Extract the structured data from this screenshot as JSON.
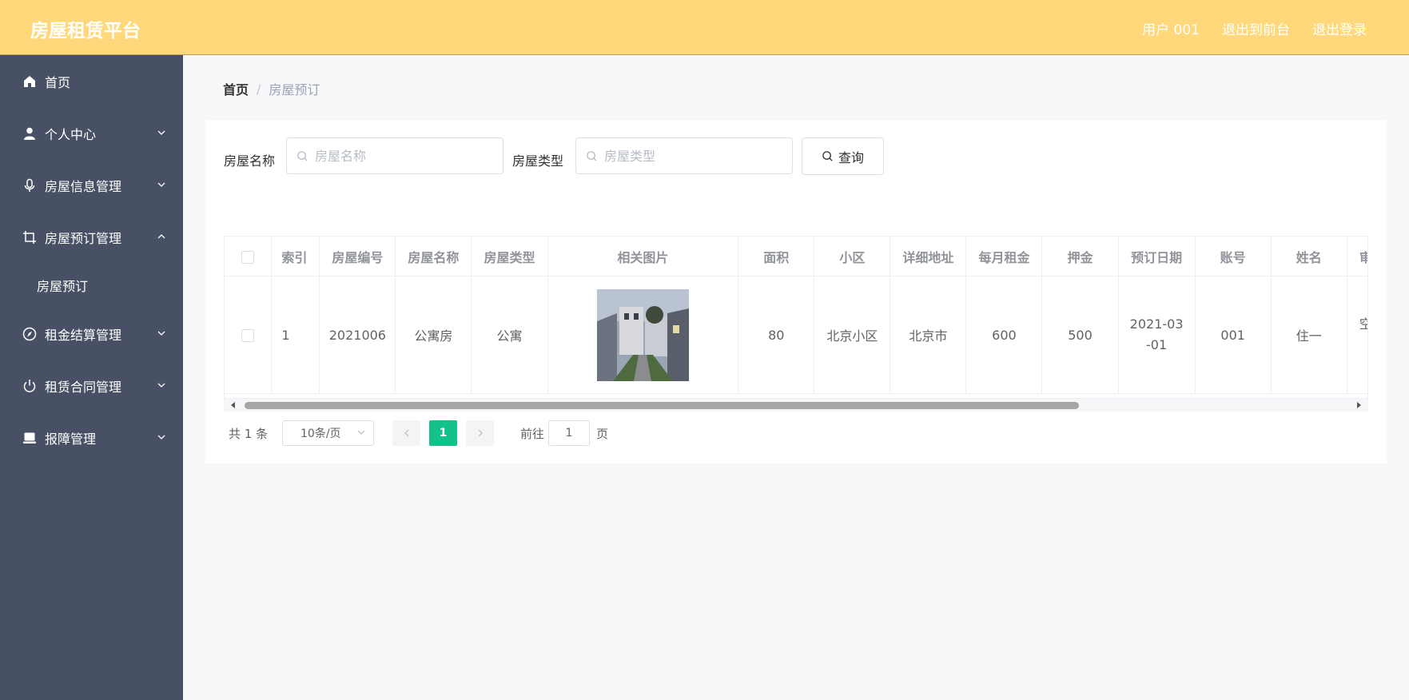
{
  "app": {
    "title": "房屋租赁平台"
  },
  "header": {
    "links": [
      "用户 001",
      "退出到前台",
      "退出登录"
    ]
  },
  "sidebar": {
    "items": [
      {
        "label": "首页",
        "icon": "home-icon",
        "expanded": null
      },
      {
        "label": "个人中心",
        "icon": "user-icon",
        "expanded": false
      },
      {
        "label": "房屋信息管理",
        "icon": "microphone-icon",
        "expanded": false
      },
      {
        "label": "房屋预订管理",
        "icon": "crop-icon",
        "expanded": true,
        "children": [
          "房屋预订"
        ]
      },
      {
        "label": "租金结算管理",
        "icon": "compass-icon",
        "expanded": false
      },
      {
        "label": "租赁合同管理",
        "icon": "power-icon",
        "expanded": false
      },
      {
        "label": "报障管理",
        "icon": "laptop-icon",
        "expanded": false
      }
    ]
  },
  "breadcrumb": {
    "home": "首页",
    "separator": "/",
    "current": "房屋预订"
  },
  "filters": {
    "name_label": "房屋名称",
    "name_placeholder": "房屋名称",
    "type_label": "房屋类型",
    "type_placeholder": "房屋类型",
    "query_button": "查询"
  },
  "table": {
    "columns": [
      "索引",
      "房屋编号",
      "房屋名称",
      "房屋类型",
      "相关图片",
      "面积",
      "小区",
      "详细地址",
      "每月租金",
      "押金",
      "预订日期",
      "账号",
      "姓名",
      "审核回复"
    ],
    "rows": [
      {
        "index": "1",
        "code": "2021006",
        "name": "公寓房",
        "type": "公寓",
        "image": "house-photo",
        "area": "80",
        "community": "北京小区",
        "address": "北京市",
        "rent": "600",
        "deposit": "500",
        "date": "2021-03-01",
        "account": "001",
        "person": "住一",
        "reply": "空房可以租"
      }
    ]
  },
  "pagination": {
    "total": "共 1 条",
    "page_size": "10条/页",
    "current_page": "1",
    "goto_label": "前往",
    "goto_value": "1",
    "goto_suffix": "页"
  },
  "colors": {
    "header_bg": "#ffd87c",
    "sidebar_bg": "#475065",
    "accent": "#13c28a"
  }
}
